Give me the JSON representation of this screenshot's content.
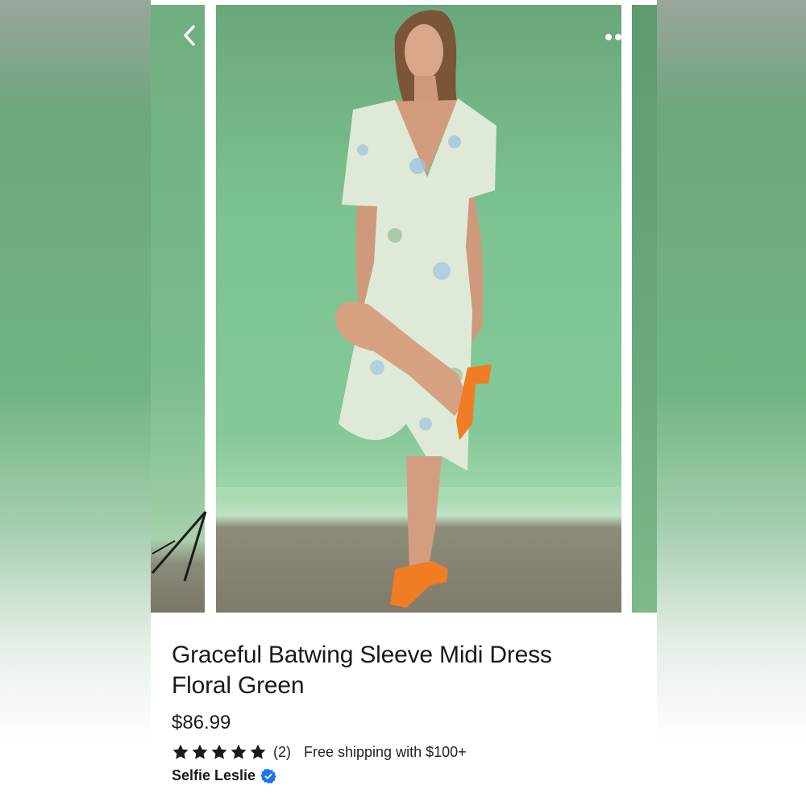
{
  "product": {
    "title_line1": "Graceful Batwing Sleeve Midi Dress",
    "title_line2": "Floral Green",
    "price": "$86.99",
    "rating": 5,
    "review_count": "(2)",
    "shipping": "Free shipping with $100+",
    "seller": "Selfie Leslie"
  },
  "icons": {
    "back": "chevron-left-icon",
    "more": "more-horizontal-icon",
    "star": "star-icon",
    "verified": "verified-badge-icon"
  },
  "colors": {
    "backdrop": "#7cc391",
    "sandals": "#f07c24",
    "verified": "#1877f2",
    "text": "#1a1a1a"
  }
}
